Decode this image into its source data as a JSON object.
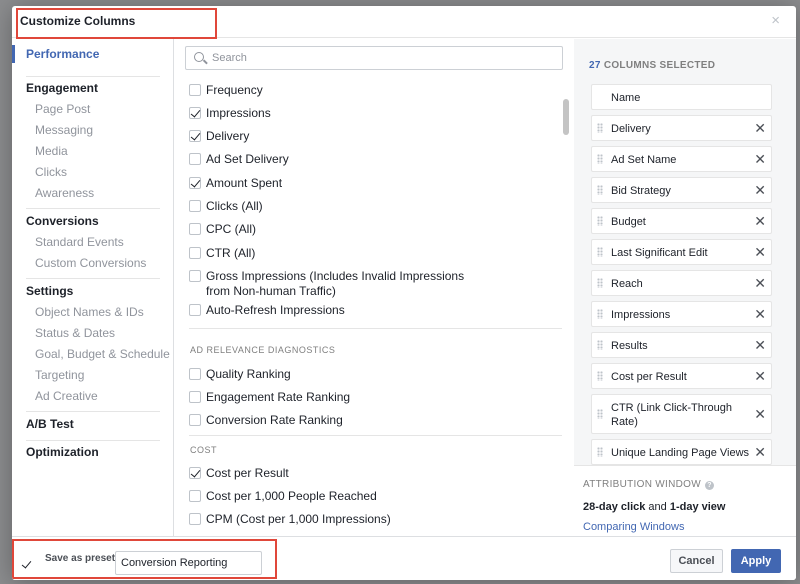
{
  "dialog": {
    "title": "Customize Columns",
    "close_glyph": "×"
  },
  "nav": {
    "items": [
      {
        "label": "Performance",
        "kind": "selected"
      },
      {
        "label": "Engagement",
        "kind": "head"
      },
      {
        "label": "Page Post",
        "kind": "sub"
      },
      {
        "label": "Messaging",
        "kind": "sub"
      },
      {
        "label": "Media",
        "kind": "sub"
      },
      {
        "label": "Clicks",
        "kind": "sub"
      },
      {
        "label": "Awareness",
        "kind": "sub"
      },
      {
        "label": "Conversions",
        "kind": "head"
      },
      {
        "label": "Standard Events",
        "kind": "sub"
      },
      {
        "label": "Custom Conversions",
        "kind": "sub"
      },
      {
        "label": "Settings",
        "kind": "head"
      },
      {
        "label": "Object Names & IDs",
        "kind": "sub"
      },
      {
        "label": "Status & Dates",
        "kind": "sub"
      },
      {
        "label": "Goal, Budget & Schedule",
        "kind": "sub"
      },
      {
        "label": "Targeting",
        "kind": "sub"
      },
      {
        "label": "Ad Creative",
        "kind": "sub"
      },
      {
        "label": "A/B Test",
        "kind": "head"
      },
      {
        "label": "Optimization",
        "kind": "head"
      }
    ]
  },
  "search": {
    "placeholder": "Search",
    "value": ""
  },
  "column_options": {
    "performance": [
      {
        "label": "Frequency",
        "checked": false
      },
      {
        "label": "Impressions",
        "checked": true
      },
      {
        "label": "Delivery",
        "checked": true
      },
      {
        "label": "Ad Set Delivery",
        "checked": false
      },
      {
        "label": "Amount Spent",
        "checked": true
      },
      {
        "label": "Clicks (All)",
        "checked": false
      },
      {
        "label": "CPC (All)",
        "checked": false
      },
      {
        "label": "CTR (All)",
        "checked": false
      },
      {
        "label": "Gross Impressions (Includes Invalid Impressions",
        "label2": "from Non-human Traffic)",
        "checked": false
      },
      {
        "label": "Auto-Refresh Impressions",
        "checked": false
      }
    ],
    "ad_relevance_heading": "AD RELEVANCE DIAGNOSTICS",
    "ad_relevance": [
      {
        "label": "Quality Ranking",
        "checked": false
      },
      {
        "label": "Engagement Rate Ranking",
        "checked": false
      },
      {
        "label": "Conversion Rate Ranking",
        "checked": false
      }
    ],
    "cost_heading": "COST",
    "cost": [
      {
        "label": "Cost per Result",
        "checked": true
      },
      {
        "label": "Cost per 1,000 People Reached",
        "checked": false
      },
      {
        "label": "CPM (Cost per 1,000 Impressions)",
        "checked": false
      }
    ]
  },
  "selected": {
    "count": "27",
    "count_label": "COLUMNS SELECTED",
    "columns": [
      {
        "label": "Name",
        "removable": false
      },
      {
        "label": "Delivery",
        "removable": true
      },
      {
        "label": "Ad Set Name",
        "removable": true
      },
      {
        "label": "Bid Strategy",
        "removable": true
      },
      {
        "label": "Budget",
        "removable": true
      },
      {
        "label": "Last Significant Edit",
        "removable": true
      },
      {
        "label": "Reach",
        "removable": true
      },
      {
        "label": "Impressions",
        "removable": true
      },
      {
        "label": "Results",
        "removable": true
      },
      {
        "label": "Cost per Result",
        "removable": true
      },
      {
        "label": "CTR (Link Click-Through Rate)",
        "removable": true
      },
      {
        "label": "Unique Landing Page Views",
        "removable": true
      }
    ],
    "remove_glyph": "✕"
  },
  "attribution": {
    "heading": "ATTRIBUTION WINDOW",
    "info_glyph": "?",
    "click": "28-day click",
    "and": " and ",
    "view": "1-day view",
    "link": "Comparing Windows"
  },
  "footer": {
    "preset_checked": true,
    "preset_label": "Save as preset",
    "preset_value": "Conversion Reporting",
    "cancel": "Cancel",
    "apply": "Apply"
  },
  "colors": {
    "accent": "#4267b2",
    "highlight_outline": "#e0473a"
  }
}
